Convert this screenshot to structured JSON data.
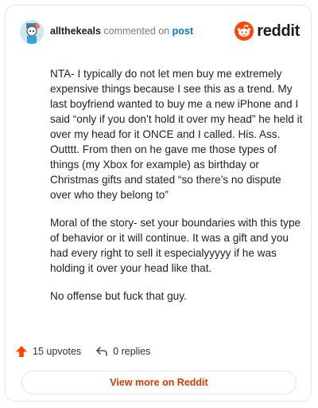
{
  "header": {
    "username": "allthekeals",
    "action_text": "commented on",
    "post_link": "post",
    "brand_name": "reddit"
  },
  "comment": {
    "paragraphs": [
      "NTA- I typically do not let men buy me extremely expensive things because I see this as a trend. My last boyfriend wanted to buy me a new iPhone and I said “only if you don’t hold it over my head” he held it over my head for it ONCE and I called. His. Ass. Outttt. From then on he gave me those types of things (my Xbox for example) as birthday or Christmas gifts and stated “so there’s no dispute over who they belong to”",
      "Moral of the story- set your boundaries with this type of behavior or it will continue. It was a gift and you had every right to sell it especialyyyyy if he was holding it over your head like that.",
      "No offense but fuck that guy."
    ]
  },
  "actions": {
    "upvotes": "15 upvotes",
    "replies": "0 replies"
  },
  "footer": {
    "view_more_label": "View more on Reddit"
  },
  "colors": {
    "accent": "#ff4500",
    "link": "#0079d3",
    "button_text": "#d93a00"
  },
  "icons": {
    "avatar": "user-avatar",
    "brand": "reddit-logo-icon",
    "upvote": "upvote-arrow-icon",
    "reply": "reply-arrow-icon"
  }
}
